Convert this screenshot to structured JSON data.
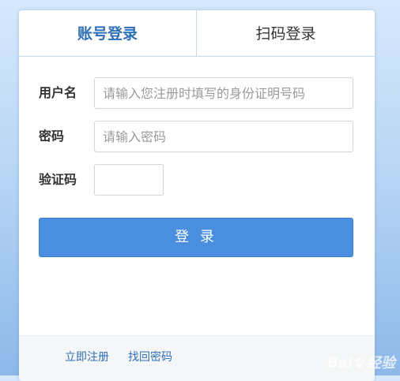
{
  "tabs": [
    {
      "label": "账号登录",
      "active": true
    },
    {
      "label": "扫码登录",
      "active": false
    }
  ],
  "form": {
    "username_label": "用户名",
    "username_placeholder": "请输入您注册时填写的身份证明号码",
    "password_label": "密码",
    "password_placeholder": "请输入密码",
    "captcha_label": "验证码",
    "login_button": "登 录"
  },
  "footer": {
    "register_link": "立即注册",
    "recover_link": "找回密码"
  },
  "watermark": {
    "text_before": "Bai",
    "text_after": "经验",
    "icon": "baidu-paw-icon"
  },
  "colors": {
    "accent": "#2f6fb5",
    "button": "#4a8fdf",
    "background_top": "#d6e8fb",
    "background_bottom": "#8db8ea"
  }
}
